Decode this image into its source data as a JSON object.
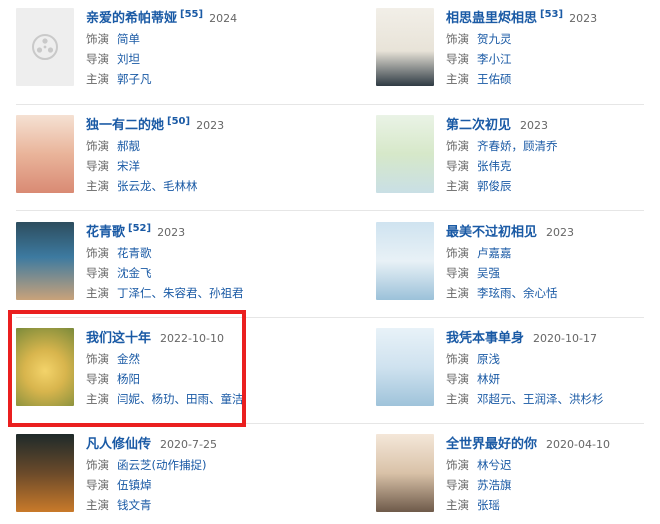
{
  "items": [
    {
      "title": "亲爱的希帕蒂娅",
      "episodes": "[55]",
      "year": "2024",
      "cast_label": "饰演",
      "cast": "简单",
      "director_label": "导演",
      "director": "刘坦",
      "star_label": "主演",
      "star": "郭子凡"
    },
    {
      "title": "相思蛊里烬相思",
      "episodes": "[53]",
      "year": "2023",
      "cast_label": "饰演",
      "cast": "贺九灵",
      "director_label": "导演",
      "director": "李小江",
      "star_label": "主演",
      "star": "王佑硕"
    },
    {
      "title": "独一有二的她",
      "episodes": "[50]",
      "year": "2023",
      "cast_label": "饰演",
      "cast": "郝靓",
      "director_label": "导演",
      "director": "宋洋",
      "star_label": "主演",
      "star": "张云龙、毛林林"
    },
    {
      "title": "第二次初见",
      "episodes": "",
      "year": "2023",
      "cast_label": "饰演",
      "cast": "齐春娇，顾清乔",
      "director_label": "导演",
      "director": "张伟克",
      "star_label": "主演",
      "star": "郭俊辰"
    },
    {
      "title": "花青歌",
      "episodes": "[52]",
      "year": "2023",
      "cast_label": "饰演",
      "cast": "花青歌",
      "director_label": "导演",
      "director": "沈金飞",
      "star_label": "主演",
      "star": "丁泽仁、朱容君、孙祖君"
    },
    {
      "title": "最美不过初相见",
      "episodes": "",
      "year": "2023",
      "cast_label": "饰演",
      "cast": "卢嘉嘉",
      "director_label": "导演",
      "director": "吴强",
      "star_label": "主演",
      "star": "李玹雨、余心恬"
    },
    {
      "title": "我们这十年",
      "episodes": "",
      "year": "2022-10-10",
      "cast_label": "饰演",
      "cast": "金然",
      "director_label": "导演",
      "director": "杨阳",
      "star_label": "主演",
      "star": "闫妮、杨玏、田雨、童洁"
    },
    {
      "title": "我凭本事单身",
      "episodes": "",
      "year": "2020-10-17",
      "cast_label": "饰演",
      "cast": "原浅",
      "director_label": "导演",
      "director": "林妍",
      "star_label": "主演",
      "star": "邓超元、王润泽、洪杉杉"
    },
    {
      "title": "凡人修仙传",
      "episodes": "",
      "year": "2020-7-25",
      "cast_label": "饰演",
      "cast": "函云芝(动作捕捉)",
      "director_label": "导演",
      "director": "伍镇焯",
      "star_label": "主演",
      "star": "钱文青"
    },
    {
      "title": "全世界最好的你",
      "episodes": "",
      "year": "2020-04-10",
      "cast_label": "饰演",
      "cast": "林兮迟",
      "director_label": "导演",
      "director": "苏浩旗",
      "star_label": "主演",
      "star": "张瑶"
    }
  ],
  "colors": {
    "link": "#1a5aa5",
    "highlight": "#ea1f1f"
  }
}
